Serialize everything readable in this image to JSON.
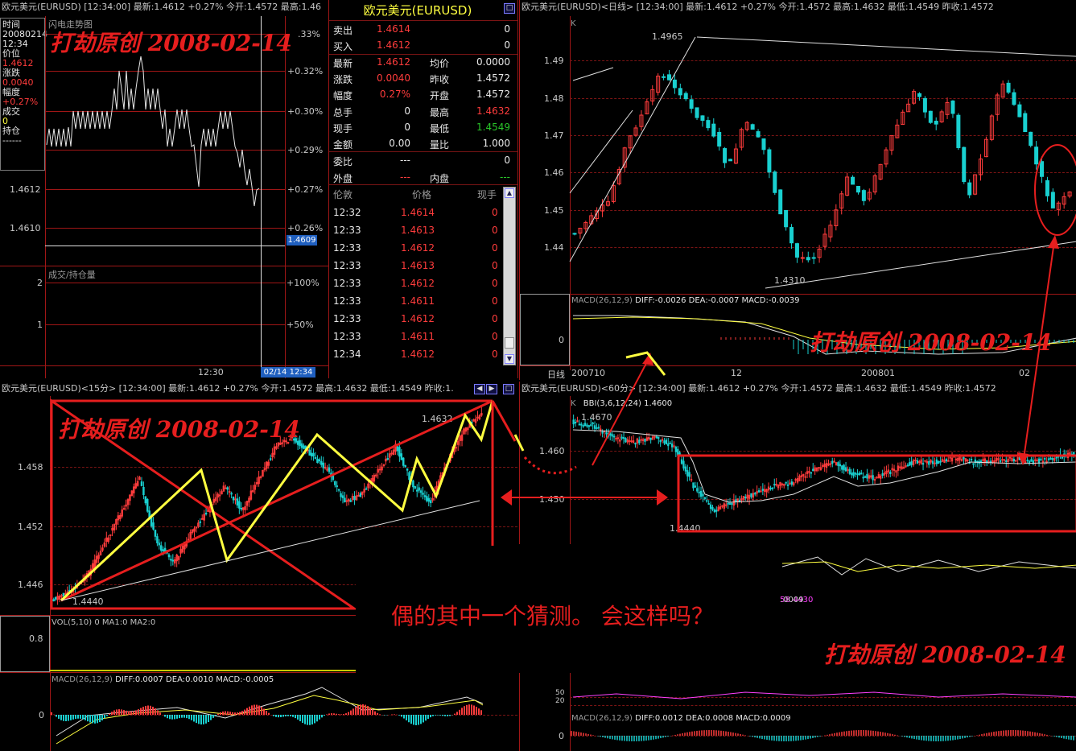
{
  "minute_panel": {
    "header": "欧元美元(EURUSD) [12:34:00] 最新:1.4612 +0.27% 今开:1.4572 最高:1.46",
    "chart_tag": "闪电走势图",
    "info": {
      "time_label": "时间",
      "date": "20080214",
      "time": "12:34",
      "price_label": "价位",
      "price": "1.4612",
      "change_label": "涨跌",
      "change": "0.0040",
      "range_label": "幅度",
      "range": "+0.27%",
      "volume_label": "成交",
      "volume": "0",
      "hold_label": "持仓",
      "hold": "------"
    },
    "price_ticks": [
      "1.4612",
      "1.4610"
    ],
    "pct_ticks": [
      ".33%",
      "+0.32%",
      "+0.30%",
      "+0.29%",
      "+0.27%",
      "+0.26%"
    ],
    "current_tag": "1.4609",
    "vol_title": "成交/持仓量",
    "vol_ticks": [
      "2",
      "1"
    ],
    "vol_pct": [
      "+100%",
      "+50%"
    ],
    "time_axis": [
      "12:30",
      "02/14 12:34"
    ]
  },
  "quote_panel": {
    "title": "欧元美元(EURUSD)",
    "rows": [
      {
        "l1": "卖出",
        "v1": "1.4614",
        "v1c": "red",
        "l2": "",
        "v2": "0"
      },
      {
        "l1": "买入",
        "v1": "1.4612",
        "v1c": "red",
        "l2": "",
        "v2": "0"
      },
      {
        "l1": "最新",
        "v1": "1.4612",
        "v1c": "red",
        "l2": "均价",
        "v2": "0.0000"
      },
      {
        "l1": "涨跌",
        "v1": "0.0040",
        "v1c": "red",
        "l2": "昨收",
        "v2": "1.4572"
      },
      {
        "l1": "幅度",
        "v1": "0.27%",
        "v1c": "red",
        "l2": "开盘",
        "v2": "1.4572"
      },
      {
        "l1": "总手",
        "v1": "0",
        "v1c": "wht",
        "l2": "最高",
        "v2": "1.4632",
        "v2c": "red"
      },
      {
        "l1": "现手",
        "v1": "0",
        "v1c": "wht",
        "l2": "最低",
        "v2": "1.4549",
        "v2c": "grn"
      },
      {
        "l1": "金额",
        "v1": "0.00",
        "v1c": "wht",
        "l2": "量比",
        "v2": "1.000"
      },
      {
        "l1": "委比",
        "v1": "---",
        "v1c": "wht",
        "l2": "",
        "v2": "0"
      },
      {
        "l1": "外盘",
        "v1": "---",
        "v1c": "red",
        "l2": "内盘",
        "v2": "---",
        "v2c": "grn"
      }
    ],
    "ticks_header": [
      "伦敦",
      "价格",
      "现手"
    ],
    "ticks": [
      {
        "t": "12:32",
        "p": "1.4614",
        "v": "0"
      },
      {
        "t": "12:33",
        "p": "1.4613",
        "v": "0"
      },
      {
        "t": "12:33",
        "p": "1.4612",
        "v": "0"
      },
      {
        "t": "12:33",
        "p": "1.4613",
        "v": "0"
      },
      {
        "t": "12:33",
        "p": "1.4612",
        "v": "0"
      },
      {
        "t": "12:33",
        "p": "1.4611",
        "v": "0"
      },
      {
        "t": "12:33",
        "p": "1.4612",
        "v": "0"
      },
      {
        "t": "12:33",
        "p": "1.4611",
        "v": "0"
      },
      {
        "t": "12:34",
        "p": "1.4612",
        "v": "0"
      }
    ]
  },
  "daily_panel": {
    "header": "欧元美元(EURUSD)<日线> [12:34:00] 最新:1.4612 +0.27% 今开:1.4572 最高:1.4632 最低:1.4549 昨收:1.4572",
    "k_label": "K",
    "y_ticks": [
      "1.49",
      "1.48",
      "1.47",
      "1.46",
      "1.45",
      "1.44"
    ],
    "high_label": "1.4965",
    "low_label": "1.4310",
    "macd_title": "MACD(26,12,9)",
    "macd_values": "DIFF:-0.0026 DEA:-0.0007 MACD:-0.0039",
    "macd_zero": "0",
    "period_label": "日线",
    "x_ticks": [
      "200710",
      "12",
      "200801",
      "02"
    ]
  },
  "m15_panel": {
    "header": "欧元美元(EURUSD)<15分> [12:34:00] 最新:1.4612 +0.27% 今开:1.4572 最高:1.4632 最低:1.4549 昨收:1.",
    "y_ticks": [
      "1.458",
      "1.452",
      "1.446"
    ],
    "high_label": "1.4632",
    "low_label": "1.4440",
    "vol_title": "VOL(5,10) 0 MA1:0 MA2:0",
    "vol_tick": "0.8",
    "macd_title": "MACD(26,12,9)",
    "macd_values": "DIFF:0.0007 DEA:0.0010 MACD:-0.0005",
    "macd_zero": "0"
  },
  "m60_panel": {
    "header": "欧元美元(EURUSD)<60分> [12:34:00] 最新:1.4612 +0.27% 今开:1.4572 最高:1.4632 最低:1.4549 昨收:1.4572",
    "k_label": "K",
    "bbi": "BBI(3,6,12,24) 1.4600",
    "y_ticks": [
      "1.460",
      "1.450"
    ],
    "high_label": "1.4670",
    "low_label": "1.4440",
    "rsi_value": "58.4430",
    "sub_value": ".0009",
    "sub_ticks": [
      "50",
      "20"
    ],
    "macd_title": "MACD(26,12,9)",
    "macd_values": "DIFF:0.0012 DEA:0.0008 MACD:0.0009",
    "macd_zero": "0"
  },
  "watermark": "打劫原创 2008-02-14",
  "annotation": "偶的其中一个猜测。 会这样吗？",
  "colors": {
    "up": "#ff3c3c",
    "down": "#19d0d0",
    "grid": "#a01616",
    "watermark": "#e61e1e",
    "trend": "#ffff40"
  }
}
